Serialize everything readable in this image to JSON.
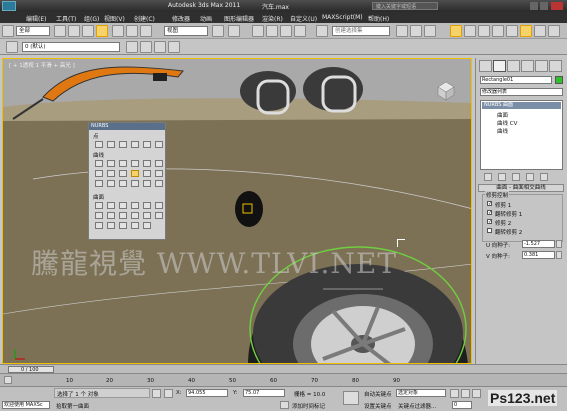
{
  "window": {
    "title": "Autodesk 3ds Max  2011",
    "file": "汽车.max",
    "search_placeholder": "键入关键字或短语"
  },
  "menu": [
    "编辑(E)",
    "工具(T)",
    "组(G)",
    "视图(V)",
    "创建(C)",
    "修改器",
    "动画",
    "图形编辑器",
    "渲染(R)",
    "自定义(U)",
    "MAXScript(M)",
    "帮助(H)"
  ],
  "toolbar": {
    "filter_value": "全部",
    "view_value": "视图",
    "selection_set_placeholder": "创建选择集"
  },
  "toolbar2": {
    "layer_value": "0 (默认)"
  },
  "viewport": {
    "label": "[ + 1透视 1 平滑 + 高光 ]",
    "watermark": "騰龍視覺 WWW.TLVI.NET"
  },
  "nurbs_tray": {
    "title": "NURBS",
    "section_points": "点",
    "section_curves": "曲线",
    "section_surfaces": "曲面"
  },
  "command_panel": {
    "object_name": "Rectangle01",
    "modifier_list": "修改器列表",
    "stack": {
      "root": "NURBS 曲面",
      "items": [
        "曲面",
        "曲线 CV",
        "曲线"
      ]
    },
    "rollout_title": "曲面 - 曲面相交曲线",
    "group_title": "修剪控制",
    "options": [
      {
        "label": "修剪 1",
        "checked": true
      },
      {
        "label": "翻转修剪 1",
        "checked": true
      },
      {
        "label": "修剪 2",
        "checked": true
      },
      {
        "label": "翻转修剪 2",
        "checked": false
      }
    ],
    "u_seed_label": "U 向种子:",
    "u_seed_value": "-1.527",
    "v_seed_label": "V 向种子:",
    "v_seed_value": "0.381"
  },
  "timeline": {
    "frame": "0 / 100",
    "ticks": [
      "10",
      "20",
      "30",
      "40",
      "50",
      "60",
      "70",
      "80",
      "90"
    ]
  },
  "status": {
    "selection": "选择了 1 个 对象",
    "prompt": "拾取第一曲面",
    "welcome": "欢迎使用 MAXSc",
    "x_label": "X:",
    "x_value": "94.055",
    "y_label": "Y:",
    "y_value": "75.07",
    "grid": "栅格 = 10.0",
    "add_time_tag": "添加时间标记",
    "auto_key": "自动关键点",
    "set_key": "设置关键点",
    "key_filter": "选定对象",
    "key_filters_btn": "关键点过滤器...",
    "frame_value": "0"
  },
  "logo": "Ps123.net",
  "colors": {
    "accent": "#f0c000",
    "frame_dark": "#2f2f2f",
    "viewport_bg": "#a9a9a9",
    "car_body": "#7d7155",
    "tire": "#3a3a3a"
  }
}
